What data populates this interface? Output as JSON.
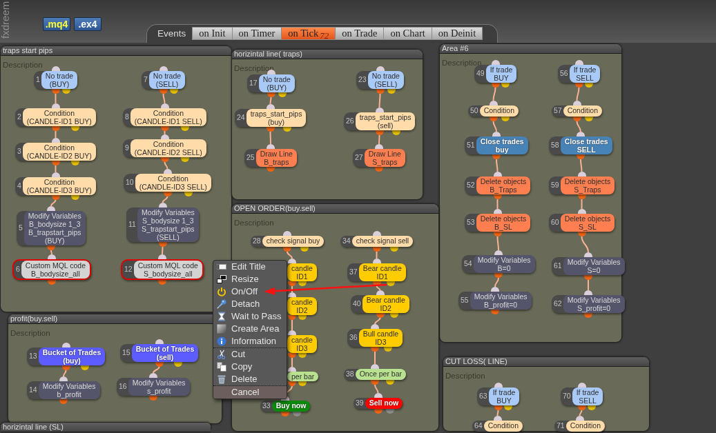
{
  "header": {
    "logo": "fxdreem",
    "file_buttons": [
      {
        "label": ".mq4",
        "selected": true
      },
      {
        "label": ".ex4",
        "selected": false
      }
    ],
    "events": {
      "label": "Events",
      "tabs": [
        {
          "label": "on Init",
          "selected": false
        },
        {
          "label": "on Timer",
          "selected": false
        },
        {
          "label": "on Tick",
          "selected": true,
          "count": "72"
        },
        {
          "label": "on Trade",
          "selected": false
        },
        {
          "label": "on Chart",
          "selected": false
        },
        {
          "label": "on Deinit",
          "selected": false
        }
      ]
    }
  },
  "areas": [
    {
      "title": "traps start pips",
      "description": "Description",
      "columns": [
        [
          {
            "number": "1",
            "label": "No trade\n(BUY)",
            "kind": "filter",
            "color": "#a9c9f7",
            "selected": false
          },
          {
            "number": "2",
            "label": "Condition\n(CANDLE-ID1 BUY)",
            "kind": "filter",
            "color": "#ffdcaa",
            "selected": false
          },
          {
            "number": "3",
            "label": "Condition\n(CANDLE-ID2 BUY)",
            "kind": "filter",
            "color": "#ffdcaa",
            "selected": false
          },
          {
            "number": "4",
            "label": "Condition\n(CANDLE-ID3 BUY)",
            "kind": "filter",
            "color": "#ffdcaa",
            "selected": false
          },
          {
            "number": "5",
            "label": "Modify Variables\nB_bodysize 1_3\nB_trapstart_pips\n(BUY)",
            "kind": "variables",
            "color": "#54556a",
            "selected": false
          },
          {
            "number": "6",
            "label": "Custom MQL code\nB_bodysize_all",
            "kind": "action",
            "color": "#d3d3d3",
            "selected": true
          }
        ],
        [
          {
            "number": "7",
            "label": "No trade\n(SELL)",
            "kind": "filter",
            "color": "#a9c9f7",
            "selected": false
          },
          {
            "number": "8",
            "label": "Condition\n(CANDLE-ID1 SELL)",
            "kind": "filter",
            "color": "#ffdcaa",
            "selected": false
          },
          {
            "number": "9",
            "label": "Condition\n(CANDLE-ID2 SELL)",
            "kind": "filter",
            "color": "#ffdcaa",
            "selected": false
          },
          {
            "number": "10",
            "label": "Condition\n(CANDLE-ID3 SELL)",
            "kind": "filter",
            "color": "#ffdcaa",
            "selected": false
          },
          {
            "number": "11",
            "label": "Modify Variables\nS_bodysize 1_3\nS_trapstart_pips\n(SELL)",
            "kind": "variables",
            "color": "#54556a",
            "selected": false
          },
          {
            "number": "12",
            "label": "Custom MQL code\nS_bodysize_all",
            "kind": "action",
            "color": "#d3d3d3",
            "selected": true
          }
        ]
      ]
    },
    {
      "title": "horizintal line( traps)",
      "description": "Description",
      "columns": [
        [
          {
            "number": "17",
            "label": "No trade\n(BUY)",
            "kind": "filter",
            "color": "#a9c9f7",
            "selected": false
          },
          {
            "number": "24",
            "label": "traps_start_pips\n(buy)",
            "kind": "filter",
            "color": "#ffdcaa",
            "selected": false
          },
          {
            "number": "25",
            "label": "Draw Line\nB_traps",
            "kind": "action",
            "color": "#ff7f50",
            "selected": false
          }
        ],
        [
          {
            "number": "23",
            "label": "No trade\n(SELL)",
            "kind": "filter",
            "color": "#a9c9f7",
            "selected": false
          },
          {
            "number": "26",
            "label": "traps_start_pips\n(sell)",
            "kind": "filter",
            "color": "#ffdcaa",
            "selected": false
          },
          {
            "number": "27",
            "label": "Draw Line\nS_traps",
            "kind": "action",
            "color": "#ff7f50",
            "selected": false
          }
        ]
      ]
    },
    {
      "title": "Area #6",
      "description": "Description",
      "columns": [
        [
          {
            "number": "49",
            "label": "If trade\nBUY",
            "kind": "filter",
            "color": "#a9c9f7",
            "selected": false
          },
          {
            "number": "50",
            "label": "Condition",
            "kind": "filter",
            "color": "#ffdcaa",
            "selected": false
          },
          {
            "number": "51",
            "label": "Close trades\nbuy",
            "kind": "close",
            "color": "#4883b8",
            "selected": false
          },
          {
            "number": "52",
            "label": "Delete objects\nB_Traps",
            "kind": "action",
            "color": "#ff7f50",
            "selected": false
          },
          {
            "number": "53",
            "label": "Delete objects\nB_SL",
            "kind": "action",
            "color": "#ff7f50",
            "selected": false
          },
          {
            "number": "54",
            "label": "Modify Variables\nB=0",
            "kind": "variables",
            "color": "#54556a",
            "selected": false
          },
          {
            "number": "55",
            "label": "Modify Variables\nB_profit=0",
            "kind": "variables",
            "color": "#54556a",
            "selected": false
          }
        ],
        [
          {
            "number": "56",
            "label": "If trade\nSELL",
            "kind": "filter",
            "color": "#a9c9f7",
            "selected": false
          },
          {
            "number": "57",
            "label": "Condition",
            "kind": "filter",
            "color": "#ffdcaa",
            "selected": false
          },
          {
            "number": "58",
            "label": "Close trades\nSELL",
            "kind": "close",
            "color": "#4883b8",
            "selected": false
          },
          {
            "number": "59",
            "label": "Delete objects\nS_Traps",
            "kind": "action",
            "color": "#ff7f50",
            "selected": false
          },
          {
            "number": "60",
            "label": "Delete objects\nS_SL",
            "kind": "action",
            "color": "#ff7f50",
            "selected": false
          },
          {
            "number": "61",
            "label": "Modify Variables\nS=0",
            "kind": "variables",
            "color": "#54556a",
            "selected": false
          },
          {
            "number": "62",
            "label": "Modify Variables\nS_profit=0",
            "kind": "variables",
            "color": "#54556a",
            "selected": false
          }
        ]
      ]
    },
    {
      "title": "OPEN ORDER(buy.sell)",
      "description": "Description",
      "columns": [
        [
          {
            "number": "28",
            "label": "check signal buy",
            "kind": "filter",
            "color": "#ffdcaa",
            "selected": false
          },
          {
            "label": "candle\nID1",
            "kind": "filter",
            "color": "#ffcc00",
            "selected": false
          },
          {
            "label": "candle\nID2",
            "kind": "filter",
            "color": "#ffcc00",
            "selected": false
          },
          {
            "label": "candle\nID3",
            "kind": "filter",
            "color": "#ffcc00",
            "selected": false
          },
          {
            "label": "per bar",
            "kind": "filter",
            "color": "#b8e290",
            "selected": false
          },
          {
            "number": "33",
            "label": "Buy now",
            "kind": "order",
            "color": "#0c8a0c",
            "selected": false
          }
        ],
        [
          {
            "number": "34",
            "label": "check signal sell",
            "kind": "filter",
            "color": "#ffdcaa",
            "selected": false
          },
          {
            "number": "37",
            "label": "Bear candle\nID1",
            "kind": "filter",
            "color": "#ffcc00",
            "selected": false
          },
          {
            "number": "40",
            "label": "Bear candle\nID2",
            "kind": "filter",
            "color": "#ffcc00",
            "selected": false
          },
          {
            "number": "36",
            "label": "Bull candle\nID3",
            "kind": "filter",
            "color": "#ffcc00",
            "selected": false
          },
          {
            "number": "38",
            "label": "Once per bar",
            "kind": "filter",
            "color": "#b8e290",
            "selected": false
          },
          {
            "number": "39",
            "label": "Sell now",
            "kind": "order",
            "color": "#ff0000",
            "selected": false
          }
        ]
      ]
    },
    {
      "title": "profit(buy.sell)",
      "description": "Description",
      "columns": [
        [
          {
            "number": "13",
            "label": "Bucket of Trades\n(buy)",
            "kind": "bucket",
            "color": "#5c5cff",
            "selected": false
          },
          {
            "number": "14",
            "label": "Modify Variables\nb_profit",
            "kind": "variables",
            "color": "#54556a",
            "selected": false
          }
        ],
        [
          {
            "number": "15",
            "label": "Bucket of Trades\n(sell)",
            "kind": "bucket",
            "color": "#5c5cff",
            "selected": false
          },
          {
            "number": "16",
            "label": "Modify Variables\ns_profit",
            "kind": "variables",
            "color": "#54556a",
            "selected": false
          }
        ]
      ]
    },
    {
      "title": "CUT LOSS( LINE)",
      "description": "Description",
      "columns": [
        [
          {
            "number": "63",
            "label": "If trade\nBUY",
            "kind": "filter",
            "color": "#a9c9f7",
            "selected": false
          },
          {
            "number": "64",
            "label": "Condition",
            "kind": "filter",
            "color": "#ffdcaa",
            "selected": false
          }
        ],
        [
          {
            "number": "70",
            "label": "If trade\nSELL",
            "kind": "filter",
            "color": "#a9c9f7",
            "selected": false
          },
          {
            "number": "71",
            "label": "Condition",
            "kind": "filter",
            "color": "#ffdcaa",
            "selected": false
          }
        ]
      ]
    },
    {
      "title": "horizintal line (SL)"
    }
  ],
  "context_menu": {
    "groups": [
      [
        {
          "label": "Edit Title",
          "highlighted": false
        },
        {
          "label": "Resize",
          "highlighted": false
        },
        {
          "label": "On/Off",
          "highlighted": false
        },
        {
          "label": "Detach",
          "highlighted": false
        },
        {
          "label": "Wait to Pass",
          "highlighted": false
        },
        {
          "label": "Create Area",
          "highlighted": false
        },
        {
          "label": "Information",
          "highlighted": false
        }
      ],
      [
        {
          "label": "Cut",
          "highlighted": false
        },
        {
          "label": "Copy",
          "highlighted": false
        },
        {
          "label": "Delete",
          "highlighted": false
        }
      ],
      [
        {
          "label": "Cancel",
          "highlighted": true
        }
      ]
    ]
  },
  "annotations": [
    {
      "kind": "arrow"
    }
  ]
}
